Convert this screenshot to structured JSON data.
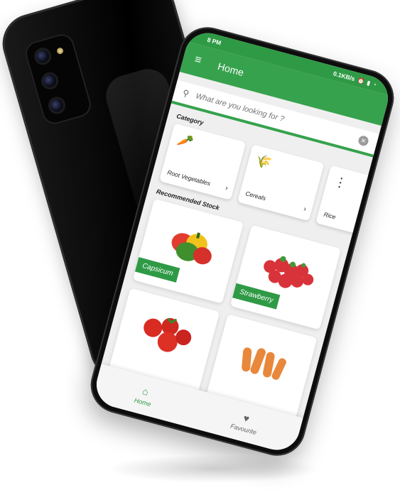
{
  "status_bar": {
    "time": "8 PM",
    "network_speed": "0.1KB/s",
    "icons": [
      "alarm-icon",
      "battery-icon",
      "wifi-icon"
    ]
  },
  "app_bar": {
    "title": "Home",
    "menu_icon": "hamburger-menu-icon"
  },
  "search": {
    "placeholder": "What are you looking for ?",
    "value": "",
    "search_icon": "search-icon",
    "clear_icon": "close-icon"
  },
  "category": {
    "title": "Category",
    "items": [
      {
        "label": "Root Vegetables",
        "icon": "carrot-icon"
      },
      {
        "label": "Cereals",
        "icon": "grain-icon"
      },
      {
        "label": "Rice",
        "icon": "rice-icon"
      }
    ]
  },
  "recommended": {
    "title": "Recommended Stock",
    "items": [
      {
        "label": "Capsicum",
        "image": "capsicum"
      },
      {
        "label": "Strawberry",
        "image": "strawberry"
      },
      {
        "label": "",
        "image": "tomato"
      },
      {
        "label": "",
        "image": "carrot"
      }
    ]
  },
  "bottom_nav": {
    "items": [
      {
        "label": "Home",
        "icon": "home-icon",
        "active": true
      },
      {
        "label": "Favourite",
        "icon": "heart-icon",
        "active": false
      }
    ]
  },
  "colors": {
    "brand_green": "#36a24d",
    "status_green": "#2f9a45"
  }
}
